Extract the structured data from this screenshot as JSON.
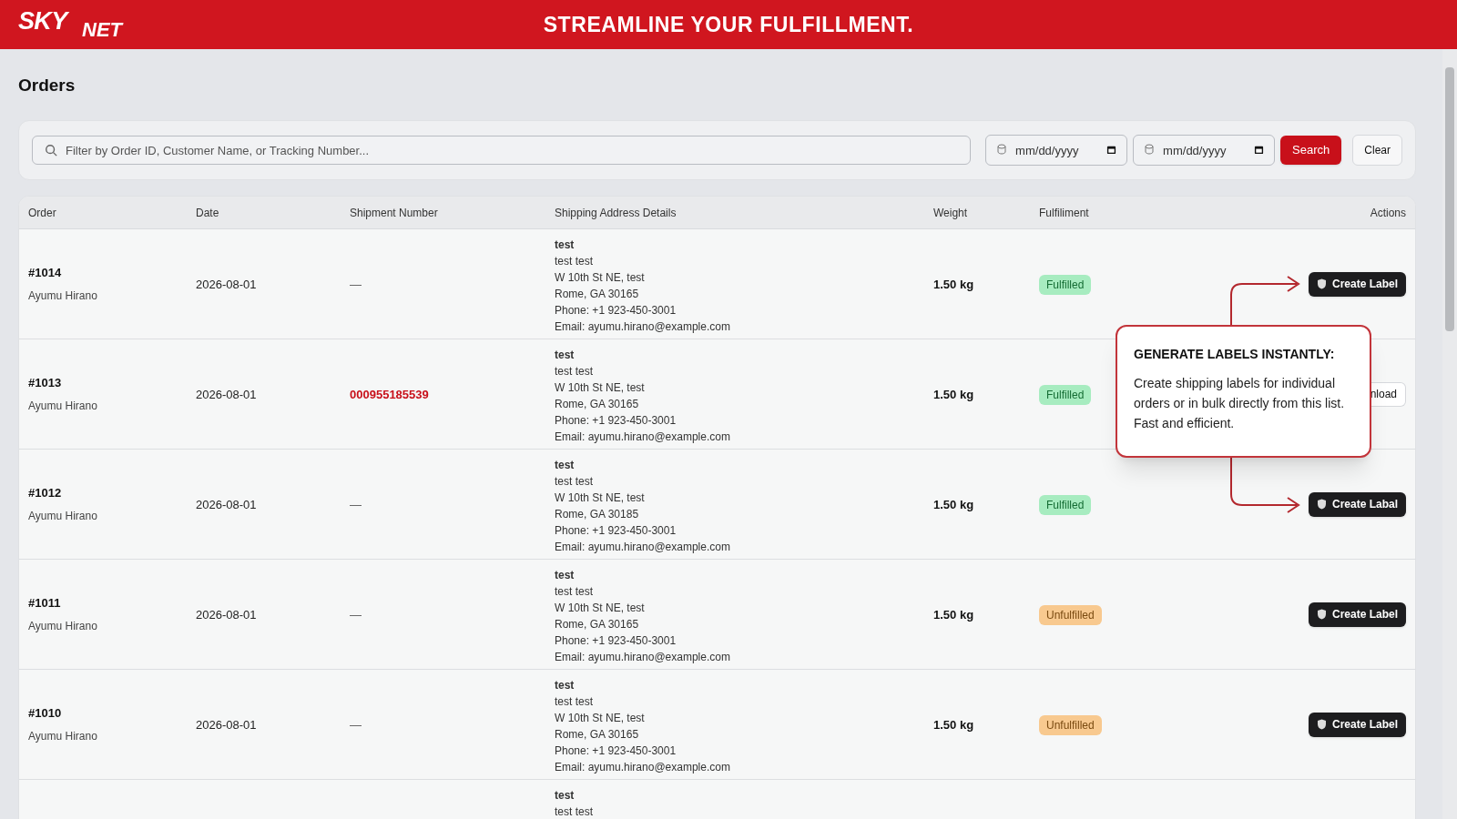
{
  "header": {
    "logo_top": "SKY",
    "logo_bottom": "NET",
    "tagline": "STREAMLINE YOUR FULFILLMENT."
  },
  "page_title": "Orders",
  "filters": {
    "search_placeholder": "Filter by Order ID, Customer Name, or Tracking Number...",
    "date_from_placeholder": "mm/dd/yyyy",
    "date_to_placeholder": "mm/dd/yyyy",
    "search_button": "Search",
    "clear_button": "Clear"
  },
  "table": {
    "columns": [
      "Order",
      "Date",
      "Shipment Number",
      "Shipping Address Details",
      "Weight",
      "Fulfiliment",
      "Actions"
    ],
    "rows": [
      {
        "order": "#1014",
        "customer": "Ayumu Hirano",
        "date": "2026-08-01",
        "shipment": {
          "kind": "none",
          "text": "—"
        },
        "address": [
          "test",
          "test test",
          "W 10th St NE, test",
          "Rome, GA 30165",
          "Phone: +1 923-450-3001",
          "Email: ayumu.hirano@example.com"
        ],
        "weight": "1.50 kg",
        "status": {
          "kind": "fulfilled",
          "text": "Fulfilled"
        },
        "action": {
          "kind": "create_label",
          "label": "Create Label"
        }
      },
      {
        "order": "#1013",
        "customer": "Ayumu Hirano",
        "date": "2026-08-01",
        "shipment": {
          "kind": "tracking",
          "text": "000955185539"
        },
        "address": [
          "test",
          "test test",
          "W 10th St NE, test",
          "Rome, GA 30165",
          "Phone: +1 923-450-3001",
          "Email: ayumu.hirano@example.com"
        ],
        "weight": "1.50 kg",
        "status": {
          "kind": "fulfilled",
          "text": "Fulfilled"
        },
        "action": {
          "kind": "download",
          "label": "nload"
        }
      },
      {
        "order": "#1012",
        "customer": "Ayumu Hirano",
        "date": "2026-08-01",
        "shipment": {
          "kind": "none",
          "text": "—"
        },
        "address": [
          "test",
          "test test",
          "W 10th St NE, test",
          "Rome, GA 30185",
          "Phone: +1 923-450-3001",
          "Email: ayumu.hirano@example.com"
        ],
        "weight": "1.50 kg",
        "status": {
          "kind": "fulfilled",
          "text": "Fulfilled"
        },
        "action": {
          "kind": "create_label",
          "label": "Create Labal"
        }
      },
      {
        "order": "#1011",
        "customer": "Ayumu Hirano",
        "date": "2026-08-01",
        "shipment": {
          "kind": "none",
          "text": "—"
        },
        "address": [
          "test",
          "test test",
          "W 10th St NE, test",
          "Rome, GA 30165",
          "Phone: +1 923-450-3001",
          "Email: ayumu.hirano@example.com"
        ],
        "weight": "1.50 kg",
        "status": {
          "kind": "unfulfilled",
          "text": "Unfulfilled"
        },
        "action": {
          "kind": "create_label",
          "label": "Create Label"
        }
      },
      {
        "order": "#1010",
        "customer": "Ayumu Hirano",
        "date": "2026-08-01",
        "shipment": {
          "kind": "none",
          "text": "—"
        },
        "address": [
          "test",
          "test test",
          "W 10th St NE, test",
          "Rome, GA 30165",
          "Phone: +1 923-450-3001",
          "Email: ayumu.hirano@example.com"
        ],
        "weight": "1.50 kg",
        "status": {
          "kind": "unfulfilled",
          "text": "Unfulfilled"
        },
        "action": {
          "kind": "create_label",
          "label": "Create Label"
        }
      },
      {
        "address": [
          "test",
          "test test"
        ]
      }
    ]
  },
  "callout": {
    "title": "GENERATE LABELS INSTANTLY:",
    "body": "Create shipping labels for individual orders or in bulk directly from this list. Fast and efficient."
  }
}
